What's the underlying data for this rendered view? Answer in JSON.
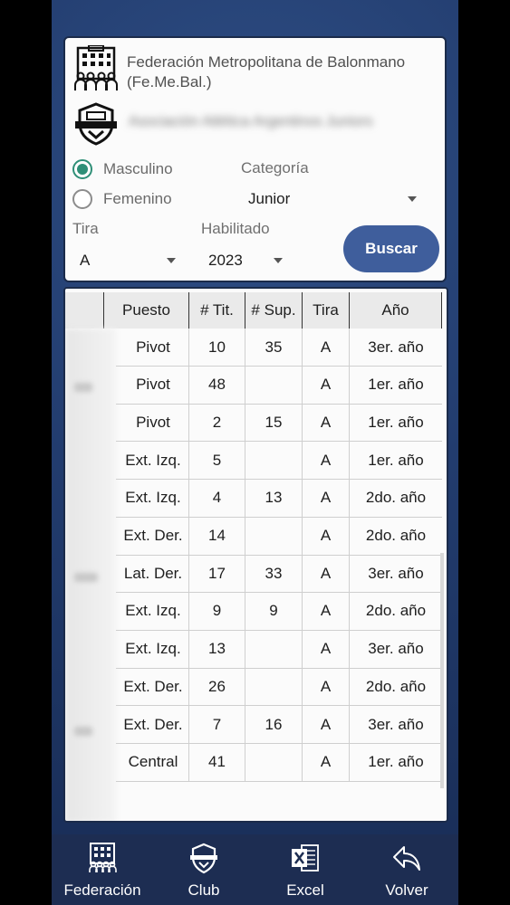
{
  "federation": {
    "name": "Federación Metropolitana de Balonmano (Fe.Me.Bal.)",
    "icon": "building-people-icon"
  },
  "club": {
    "name": "Asociación Atlética Argentinos Juniors",
    "icon": "club-shield-icon"
  },
  "filters": {
    "gender_options": [
      "Masculino",
      "Femenino"
    ],
    "gender_selected": "Masculino",
    "categoria_label": "Categoría",
    "categoria_value": "Junior",
    "tira_label": "Tira",
    "tira_value": "A",
    "habilitado_label": "Habilitado",
    "habilitado_value": "2023",
    "search_button": "Buscar"
  },
  "table": {
    "headers": [
      "Puesto",
      "# Tit.",
      "# Sup.",
      "Tira",
      "Año"
    ],
    "rows": [
      [
        "Pivot",
        "10",
        "35",
        "A",
        "3er. año"
      ],
      [
        "Pivot",
        "48",
        "",
        "A",
        "1er. año"
      ],
      [
        "Pivot",
        "2",
        "15",
        "A",
        "1er. año"
      ],
      [
        "Ext. Izq.",
        "5",
        "",
        "A",
        "1er. año"
      ],
      [
        "Ext. Izq.",
        "4",
        "13",
        "A",
        "2do. año"
      ],
      [
        "Ext. Der.",
        "14",
        "",
        "A",
        "2do. año"
      ],
      [
        "Lat. Der.",
        "17",
        "33",
        "A",
        "3er. año"
      ],
      [
        "Ext. Izq.",
        "9",
        "9",
        "A",
        "2do. año"
      ],
      [
        "Ext. Izq.",
        "13",
        "",
        "A",
        "3er. año"
      ],
      [
        "Ext. Der.",
        "26",
        "",
        "A",
        "2do. año"
      ],
      [
        "Ext. Der.",
        "7",
        "16",
        "A",
        "3er. año"
      ],
      [
        "Central",
        "41",
        "",
        "A",
        "1er. año"
      ]
    ]
  },
  "nav": [
    {
      "label": "Federación",
      "icon": "federation-building-icon"
    },
    {
      "label": "Club",
      "icon": "club-shield-icon"
    },
    {
      "label": "Excel",
      "icon": "excel-icon"
    },
    {
      "label": "Volver",
      "icon": "back-arrow-icon"
    }
  ],
  "colors": {
    "background": "#223c6e",
    "button": "#3f5e9c",
    "radio_active": "#2f8f77",
    "navbar": "#1d2d52"
  }
}
